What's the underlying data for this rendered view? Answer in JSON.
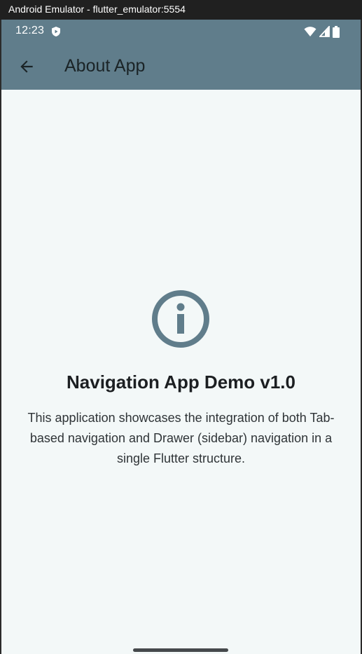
{
  "window": {
    "title": "Android Emulator - flutter_emulator:5554"
  },
  "status_bar": {
    "time": "12:23",
    "icons": [
      "shield-icon",
      "wifi-icon",
      "signal-icon",
      "battery-icon"
    ]
  },
  "app_bar": {
    "back_icon": "arrow-left-icon",
    "title": "About App",
    "background": "#607d8b"
  },
  "content": {
    "icon": "info-icon",
    "heading": "Navigation App Demo v1.0",
    "description": "This application showcases the integration of both Tab-based navigation and Drawer (sidebar) navigation in a single Flutter structure."
  },
  "colors": {
    "accent": "#607d8b",
    "background": "#f3f8f8"
  }
}
